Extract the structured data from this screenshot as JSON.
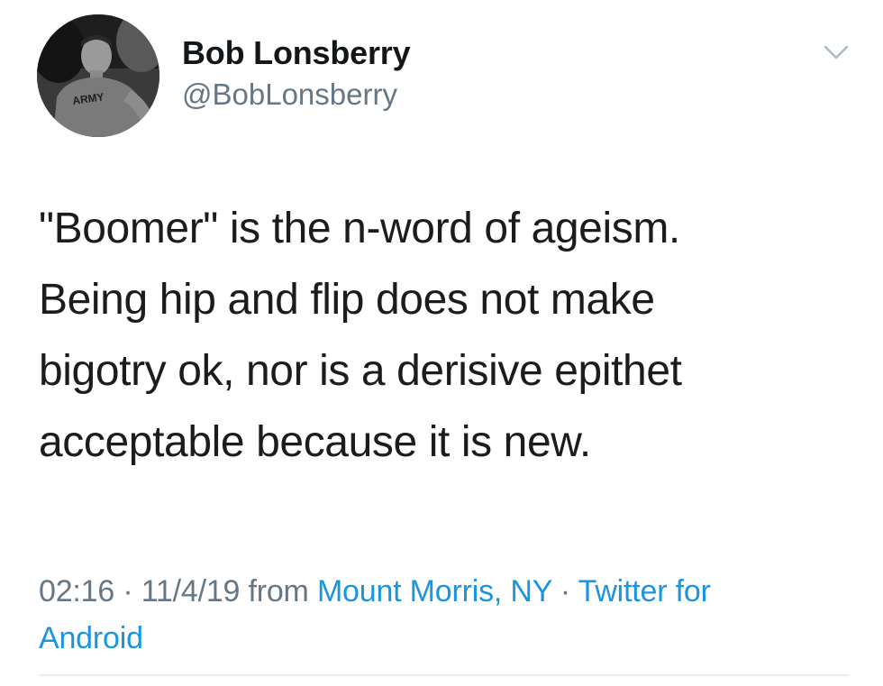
{
  "user": {
    "display_name": "Bob Lonsberry",
    "handle": "@BobLonsberry",
    "avatar_shirt_text": "ARMY"
  },
  "tweet": {
    "lines": [
      "\"Boomer\" is the n-word of ageism.",
      "Being hip and flip does not make",
      "bigotry ok, nor is a derisive epithet",
      "acceptable because it is new."
    ],
    "time": "02:16",
    "separator": " · ",
    "date": "11/4/19",
    "from_label": " from ",
    "location": "Mount Morris, NY",
    "source_part1": "Twitter for",
    "source_part2": "Android"
  },
  "icons": {
    "more": "chevron-down-icon"
  },
  "colors": {
    "text": "#14171a",
    "secondary": "#657786",
    "link": "#1b95e0",
    "divider": "#e6ecf0"
  }
}
